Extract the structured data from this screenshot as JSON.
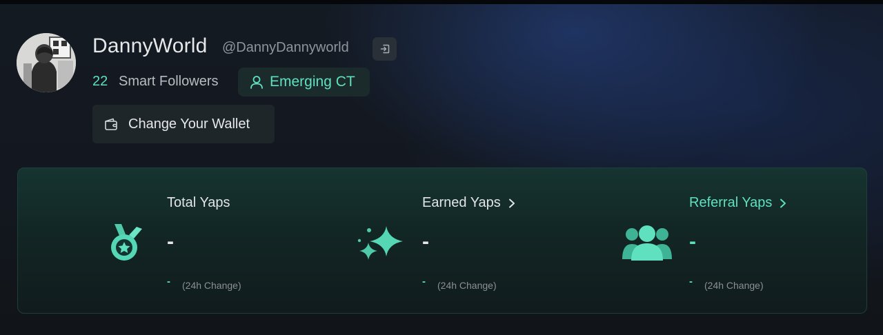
{
  "profile": {
    "name": "DannyWorld",
    "handle": "@DannyDannyworld",
    "smart_followers_count": "22",
    "smart_followers_label": "Smart Followers",
    "badge_label": "Emerging CT",
    "wallet_button_label": "Change Your Wallet"
  },
  "stats": [
    {
      "title": "Total Yaps",
      "value": "-",
      "change_value": "-",
      "change_label": "(24h Change)",
      "icon": "medal-star-icon"
    },
    {
      "title": "Earned Yaps",
      "value": "-",
      "change_value": "-",
      "change_label": "(24h Change)",
      "icon": "sparkles-icon"
    },
    {
      "title": "Referral Yaps",
      "value": "-",
      "change_value": "-",
      "change_label": "(24h Change)",
      "icon": "users-group-icon"
    }
  ],
  "colors": {
    "accent": "#5fe0bf",
    "text": "#e6e8ea",
    "muted": "#8f959b"
  }
}
